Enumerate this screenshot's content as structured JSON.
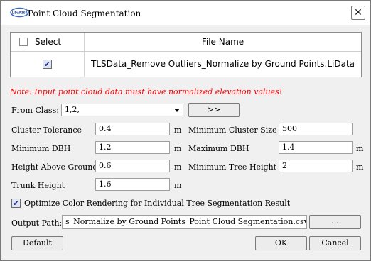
{
  "window": {
    "title": "Point Cloud Segmentation",
    "logo_text": "LiDAR360"
  },
  "table": {
    "col_select": "Select",
    "col_file": "File Name",
    "rows": [
      {
        "file_name": "TLSData_Remove Outliers_Normalize by Ground Points.LiData",
        "checked": true
      }
    ]
  },
  "note": "Note: Input point cloud data must have normalized elevation values!",
  "from_class": {
    "label": "From Class:",
    "value": "1,2,",
    "button": ">>"
  },
  "params": {
    "cluster_tolerance": {
      "label": "Cluster Tolerance",
      "value": "0.4",
      "unit": "m"
    },
    "minimum_cluster_size": {
      "label": "Minimum Cluster Size",
      "value": "500"
    },
    "minimum_dbh": {
      "label": "Minimum DBH",
      "value": "1.2",
      "unit": "m"
    },
    "maximum_dbh": {
      "label": "Maximum DBH",
      "value": "1.4",
      "unit": "m"
    },
    "height_above_ground": {
      "label": "Height Above Ground",
      "value": "0.6",
      "unit": "m"
    },
    "minimum_tree_height": {
      "label": "Minimum Tree Height",
      "value": "2",
      "unit": "m"
    },
    "trunk_height": {
      "label": "Trunk Height",
      "value": "1.6",
      "unit": "m"
    }
  },
  "optimize": {
    "label": "Optimize Color Rendering for Individual Tree Segmentation Result",
    "checked": true
  },
  "output": {
    "label": "Output Path:",
    "value": "s_Normalize by Ground Points_Point Cloud Segmentation.csv",
    "browse": "..."
  },
  "buttons": {
    "default": "Default",
    "ok": "OK",
    "cancel": "Cancel"
  }
}
